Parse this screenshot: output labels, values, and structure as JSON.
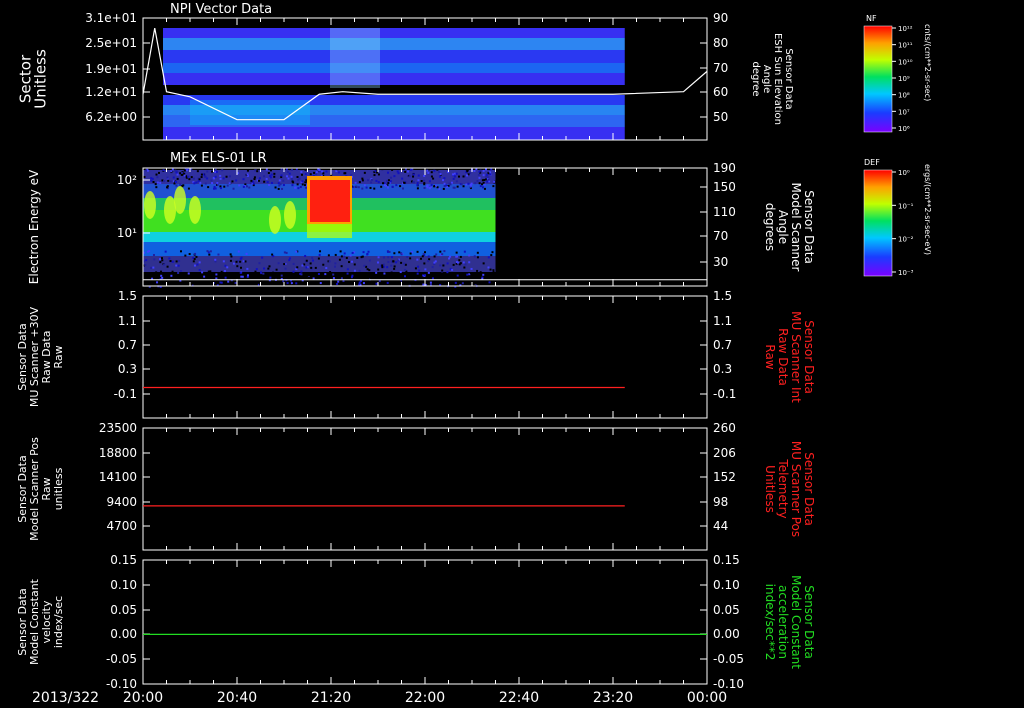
{
  "colors": {
    "background": "#000000",
    "axis": "#ffffff",
    "red_series": "#ff2020",
    "green_series": "#22dd22",
    "model_line": "#ffffff"
  },
  "date_label": "2013/322",
  "x_axis": {
    "range": [
      "20:00",
      "00:00"
    ],
    "tick_labels": [
      "20:00",
      "20:40",
      "21:20",
      "22:00",
      "22:40",
      "23:20",
      "00:00"
    ],
    "data_end": "23:25"
  },
  "colorbars": [
    {
      "title": "NF",
      "unit": "cnts/(cm**2-sr-sec)",
      "tick_labels": [
        "10¹²",
        "10¹¹",
        "10¹⁰",
        "10⁹",
        "10⁸",
        "10⁷",
        "10⁶"
      ]
    },
    {
      "title": "DEF",
      "unit": "ergs/(cm**2-sr-sec-eV)",
      "tick_labels": [
        "10⁰",
        "10⁻¹",
        "10⁻²",
        "10⁻³"
      ]
    }
  ],
  "chart_data": [
    {
      "type": "heatmap",
      "title": "NPI Vector Data",
      "ylabel": "Sector Unitless",
      "ytick_labels": [
        "3.1e+01",
        "2.5e+01",
        "1.9e+01",
        "1.2e+01",
        "6.2e+00"
      ],
      "right_ylabel": [
        "Sensor Data",
        "ESH Sun Elevation",
        "Angle",
        "degree"
      ],
      "right_ytick_labels": [
        "90",
        "80",
        "70",
        "60",
        "50"
      ],
      "line_series": {
        "name": "ESH Sun Elevation Angle",
        "x": [
          "20:00",
          "20:05",
          "20:10",
          "20:20",
          "20:40",
          "21:00",
          "21:15",
          "21:25",
          "21:40",
          "22:00",
          "23:20",
          "23:50",
          "00:00"
        ],
        "values": [
          60,
          86,
          61,
          59,
          50,
          50,
          60,
          61,
          60,
          60,
          60,
          61,
          69
        ],
        "ylim": [
          42,
          90
        ]
      },
      "x_end": "23:25"
    },
    {
      "type": "heatmap",
      "title": "MEx ELS-01 LR",
      "ylabel": "Electron Energy eV",
      "ytick_labels": [
        "10²",
        "10¹"
      ],
      "right_ylabel": [
        "Sensor Data",
        "Model Scanner",
        "Angle",
        "degrees"
      ],
      "right_ytick_labels": [
        "190",
        "150",
        "110",
        "70",
        "30"
      ],
      "line_series": {
        "name": "Model Scanner Angle",
        "x": [
          "20:00",
          "00:00"
        ],
        "values": [
          10,
          10
        ],
        "ylim": [
          0,
          190
        ]
      },
      "x_end": "22:30"
    },
    {
      "type": "line",
      "ylabel": [
        "Sensor Data",
        "MU Scanner +30V",
        "Raw Data",
        "Raw"
      ],
      "ytick_labels": [
        "1.5",
        "1.1",
        "0.7",
        "0.3",
        "-0.1"
      ],
      "ylim": [
        -0.5,
        1.5
      ],
      "right_ylabel": [
        "Sensor Data",
        "MU Scanner Int",
        "Raw Data",
        "Raw"
      ],
      "right_ytick_labels": [
        "1.5",
        "1.1",
        "0.7",
        "0.3",
        "-0.1"
      ],
      "series": [
        {
          "x": [
            "20:00",
            "23:25"
          ],
          "values": [
            0.0,
            0.0
          ],
          "color": "#ff2020"
        }
      ]
    },
    {
      "type": "line",
      "ylabel": [
        "Sensor Data",
        "Model Scanner Pos",
        "Raw",
        "unitless"
      ],
      "ytick_labels": [
        "23500",
        "18800",
        "14100",
        "9400",
        "4700"
      ],
      "ylim": [
        0,
        23500
      ],
      "right_ylabel": [
        "Sensor Data",
        "MU Scanner Pos",
        "Telemetry",
        "Unitless"
      ],
      "right_ytick_labels": [
        "260",
        "206",
        "152",
        "98",
        "44"
      ],
      "series": [
        {
          "x": [
            "20:00",
            "23:25"
          ],
          "values": [
            8500,
            8500
          ],
          "color": "#ff2020"
        }
      ]
    },
    {
      "type": "line",
      "ylabel": [
        "Sensor Data",
        "Model Constant",
        "velocity",
        "index/sec"
      ],
      "ytick_labels": [
        "0.15",
        "0.10",
        "0.05",
        "0.00",
        "-0.05",
        "-0.10"
      ],
      "ylim": [
        -0.1,
        0.15
      ],
      "right_ylabel": [
        "Sensor Data",
        "Model Constant",
        "acceleration",
        "index/sec**2"
      ],
      "right_ytick_labels": [
        "0.15",
        "0.10",
        "0.05",
        "0.00",
        "-0.05",
        "-0.10"
      ],
      "series": [
        {
          "x": [
            "20:00",
            "00:00"
          ],
          "values": [
            0.0,
            0.0
          ],
          "color": "#22dd22"
        }
      ]
    }
  ]
}
